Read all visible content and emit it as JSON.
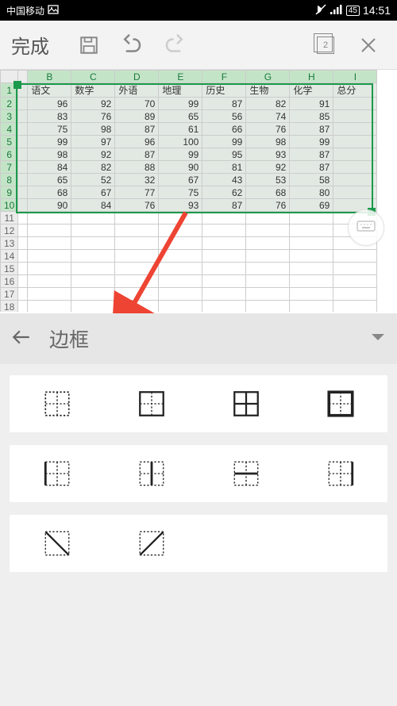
{
  "status": {
    "carrier": "中国移动",
    "battery": "45",
    "time": "14:51"
  },
  "toolbar": {
    "done": "完成"
  },
  "panel": {
    "title": "边框"
  },
  "chart_data": {
    "type": "table",
    "columns": [
      "B",
      "C",
      "D",
      "E",
      "F",
      "G",
      "H",
      "I"
    ],
    "headers": [
      "语文",
      "数学",
      "外语",
      "地理",
      "历史",
      "生物",
      "化学",
      "总分"
    ],
    "rows": [
      [
        96,
        92,
        70,
        99,
        87,
        82,
        91,
        null
      ],
      [
        83,
        76,
        89,
        65,
        56,
        74,
        85,
        null
      ],
      [
        75,
        98,
        87,
        61,
        66,
        76,
        87,
        null
      ],
      [
        99,
        97,
        96,
        100,
        99,
        98,
        99,
        null
      ],
      [
        98,
        92,
        87,
        99,
        95,
        93,
        87,
        null
      ],
      [
        84,
        82,
        88,
        90,
        81,
        92,
        87,
        null
      ],
      [
        65,
        52,
        32,
        67,
        43,
        53,
        58,
        null
      ],
      [
        68,
        67,
        77,
        75,
        62,
        68,
        80,
        null
      ],
      [
        90,
        84,
        76,
        93,
        87,
        76,
        69,
        null
      ]
    ]
  },
  "borders": {
    "options_row1": [
      "no-border",
      "outer-border",
      "all-border",
      "thick-outer"
    ],
    "options_row2": [
      "left-border",
      "inner-v",
      "inner-h",
      "right-border"
    ],
    "options_row3": [
      "diag-down",
      "diag-up"
    ]
  }
}
